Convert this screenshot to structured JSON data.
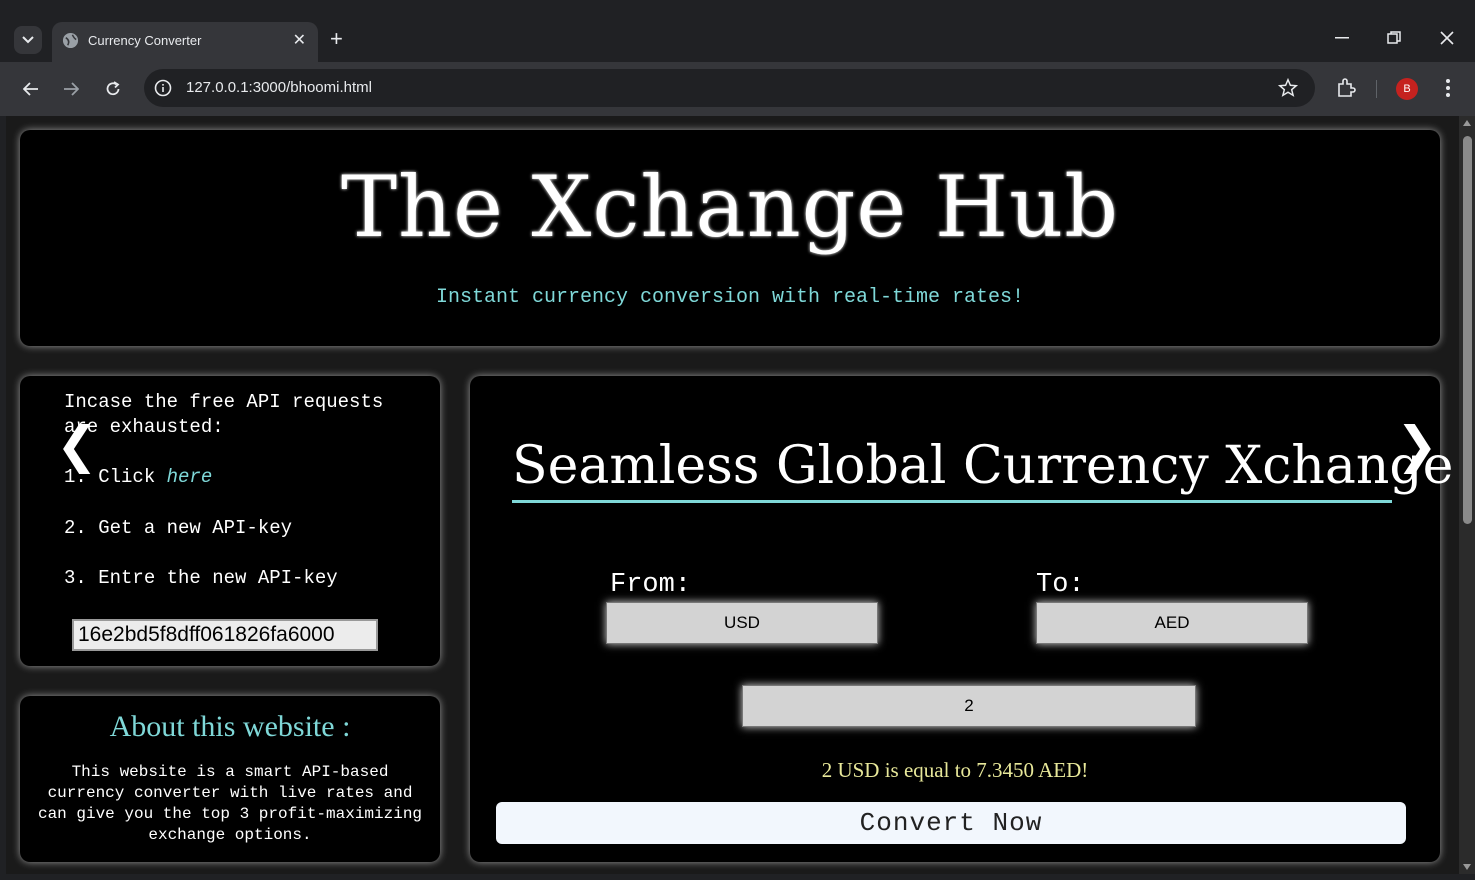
{
  "browser": {
    "tab_title": "Currency Converter",
    "url": "127.0.0.1:3000/bhoomi.html",
    "profile_initial": "B"
  },
  "header": {
    "title": "The Xchange Hub",
    "tagline": "Instant currency conversion with real-time rates!"
  },
  "api_panel": {
    "intro": "Incase the free API requests are exhausted:",
    "step1_prefix": "1. Click ",
    "step1_link": "here",
    "step2": "2. Get a new API-key",
    "step3": "3. Entre the new API-key",
    "api_key_value": "16e2bd5f8dff061826fa6000"
  },
  "about": {
    "title": "About this website :",
    "body": "This website is a smart API-based currency converter with live rates and can give you the top 3 profit-maximizing exchange options."
  },
  "converter": {
    "title": "Seamless Global Currency Xchange",
    "from_label": "From:",
    "to_label": "To:",
    "from_value": "USD",
    "to_value": "AED",
    "amount": "2",
    "result": "2 USD is equal to 7.3450 AED!",
    "convert_button": "Convert Now"
  },
  "carousel": {
    "prev_glyph": "❮",
    "next_glyph": "❯"
  },
  "colors": {
    "accent": "#7fd8d8",
    "result": "#e8e89a",
    "panel_bg": "#000000"
  }
}
